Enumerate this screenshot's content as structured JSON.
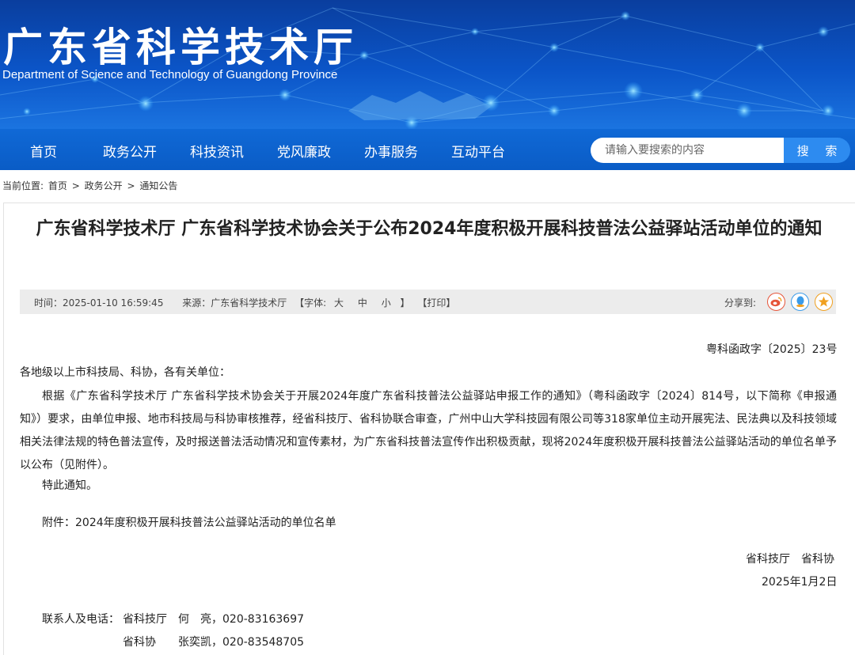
{
  "header": {
    "title": "广东省科学技术厅",
    "subtitle": "Department of Science and Technology of Guangdong Province"
  },
  "nav": {
    "items": [
      "首页",
      "政务公开",
      "科技资讯",
      "党风廉政",
      "办事服务",
      "互动平台"
    ],
    "search_placeholder": "请输入要搜索的内容",
    "search_button": "搜 索"
  },
  "breadcrumb": {
    "prefix": "当前位置:",
    "items": [
      "首页",
      ">",
      "政务公开",
      ">",
      "通知公告"
    ]
  },
  "article": {
    "title": "广东省科学技术厅 广东省科学技术协会关于公布2024年度积极开展科技普法公益驿站活动单位的通知",
    "meta": {
      "time": "时间：2025-01-10 16:59:45",
      "source": "来源：广东省科学技术厅",
      "font_label": "【字体:",
      "font_large": "大",
      "font_medium": "中",
      "font_small": "小",
      "font_close": "】",
      "print": "【打印】",
      "share_label": "分享到:"
    },
    "doc_number": "粤科函政字〔2025〕23号",
    "salutation": "各地级以上市科技局、科协，各有关单位：",
    "paragraph": "根据《广东省科学技术厅 广东省科学技术协会关于开展2024年度广东省科技普法公益驿站申报工作的通知》（粤科函政字〔2024〕814号，以下简称《申报通知》）要求，由单位申报、地市科技局与科协审核推荐，经省科技厅、省科协联合审查，广州中山大学科技园有限公司等318家单位主动开展宪法、民法典以及科技领域相关法律法规的特色普法宣传，及时报送普法活动情况和宣传素材，为广东省科技普法宣传作出积极贡献，现将2024年度积极开展科技普法公益驿站活动的单位名单予以公布（见附件）。",
    "closing": "特此通知。",
    "attachment": "附件：2024年度积极开展科技普法公益驿站活动的单位名单",
    "signature": "省科技厅　省科协",
    "date": "2025年1月2日",
    "contact_label": "联系人及电话：",
    "contact1": "省科技厅　何　亮，020-83163697",
    "contact2": "省科协　　张奕凯，020-83548705"
  },
  "colors": {
    "banner_dark": "#0a3e9e",
    "nav_blue": "#0a5cc6",
    "search_button": "#2d8bf0",
    "weibo": "#e6553a",
    "qq": "#3b9be8",
    "qzone": "#f0a020"
  },
  "icons": [
    "weibo-icon",
    "qq-icon",
    "qzone-icon"
  ]
}
